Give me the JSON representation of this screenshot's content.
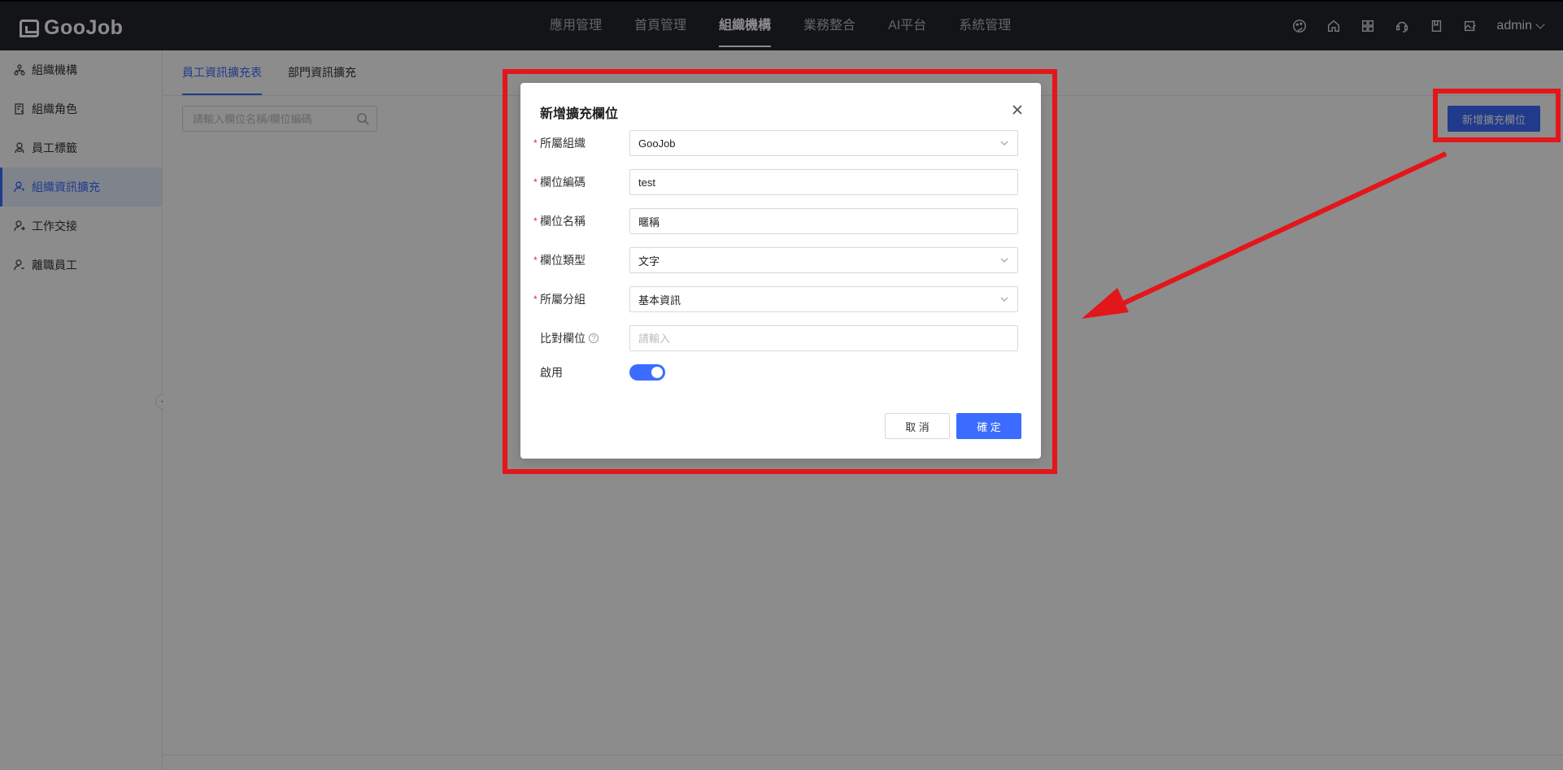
{
  "header": {
    "logo_text": "GooJob",
    "nav": [
      "應用管理",
      "首頁管理",
      "組織機構",
      "業務整合",
      "AI平台",
      "系統管理"
    ],
    "active_nav": "組織機構",
    "user": "admin"
  },
  "sidebar": {
    "items": [
      {
        "label": "組織機構",
        "icon": "org-icon"
      },
      {
        "label": "組織角色",
        "icon": "role-icon"
      },
      {
        "label": "員工標籤",
        "icon": "tag-user-icon"
      },
      {
        "label": "組織資訊擴充",
        "icon": "user-extend-icon"
      },
      {
        "label": "工作交接",
        "icon": "handover-icon"
      },
      {
        "label": "離職員工",
        "icon": "resign-icon"
      }
    ],
    "active_index": 3
  },
  "main": {
    "tabs": [
      "員工資訊擴充表",
      "部門資訊擴充"
    ],
    "search_placeholder": "請輸入欄位名稱/欄位編碼",
    "add_button": "新增擴充欄位"
  },
  "modal": {
    "title": "新增擴充欄位",
    "fields": [
      {
        "label": "所屬組織",
        "required": true,
        "type": "select",
        "value": "GooJob"
      },
      {
        "label": "欄位編碼",
        "required": true,
        "type": "input",
        "value": "test"
      },
      {
        "label": "欄位名稱",
        "required": true,
        "type": "input",
        "value": "暱稱"
      },
      {
        "label": "欄位類型",
        "required": true,
        "type": "select",
        "value": "文字"
      },
      {
        "label": "所屬分組",
        "required": true,
        "type": "select",
        "value": "基本資訊"
      },
      {
        "label": "比對欄位",
        "required": false,
        "type": "input",
        "value": "",
        "placeholder": "請輸入"
      }
    ],
    "enable_label": "啟用",
    "enabled": true,
    "cancel": "取 消",
    "ok": "確 定"
  },
  "colors": {
    "primary": "#3b6cff",
    "header_bg": "#23252b",
    "annotation": "#e3161a"
  }
}
